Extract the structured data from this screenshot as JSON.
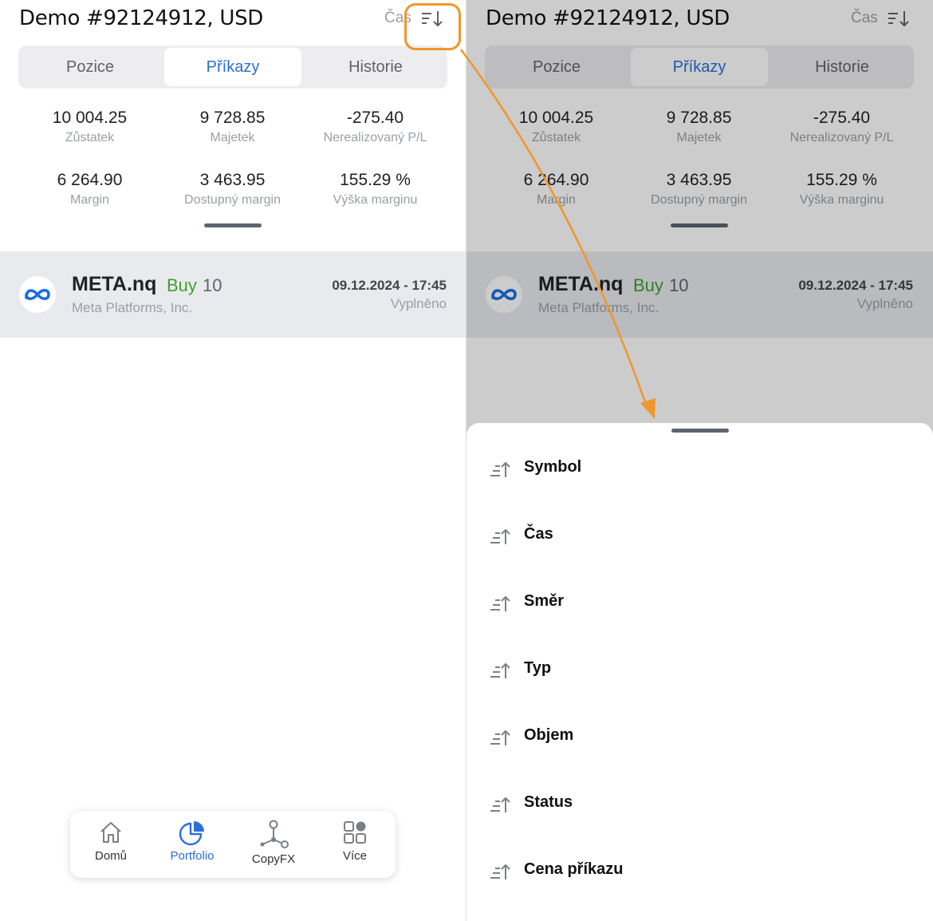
{
  "header": {
    "account_title": "Demo #92124912, USD",
    "sort_label": "Čas"
  },
  "tabs": [
    {
      "label": "Pozice",
      "active": false
    },
    {
      "label": "Příkazy",
      "active": true
    },
    {
      "label": "Historie",
      "active": false
    }
  ],
  "stats": [
    {
      "value": "10 004.25",
      "label": "Zůstatek"
    },
    {
      "value": "9 728.85",
      "label": "Majetek"
    },
    {
      "value": "-275.40",
      "label": "Nerealizovaný P/L"
    },
    {
      "value": "6 264.90",
      "label": "Margin"
    },
    {
      "value": "3 463.95",
      "label": "Dostupný margin"
    },
    {
      "value": "155.29 %",
      "label": "Výška marginu"
    }
  ],
  "order": {
    "symbol": "META.nq",
    "direction": "Buy",
    "volume": "10",
    "company": "Meta Platforms, Inc.",
    "datetime": "09.12.2024 - 17:45",
    "status": "Vyplněno"
  },
  "bottom_nav": [
    {
      "label": "Domů",
      "icon": "home-icon",
      "active": false
    },
    {
      "label": "Portfolio",
      "icon": "pie-chart-icon",
      "active": true
    },
    {
      "label": "CopyFX",
      "icon": "network-icon",
      "active": false
    },
    {
      "label": "Více",
      "icon": "grid-icon",
      "active": false
    }
  ],
  "sort_options": [
    {
      "label": "Symbol"
    },
    {
      "label": "Čas"
    },
    {
      "label": "Směr"
    },
    {
      "label": "Typ"
    },
    {
      "label": "Objem"
    },
    {
      "label": "Status"
    },
    {
      "label": "Cena příkazu"
    }
  ],
  "colors": {
    "accent": "#2a6fd6",
    "buy": "#3da02f",
    "highlight": "#f0962a",
    "row_bg": "#e9eaee"
  }
}
